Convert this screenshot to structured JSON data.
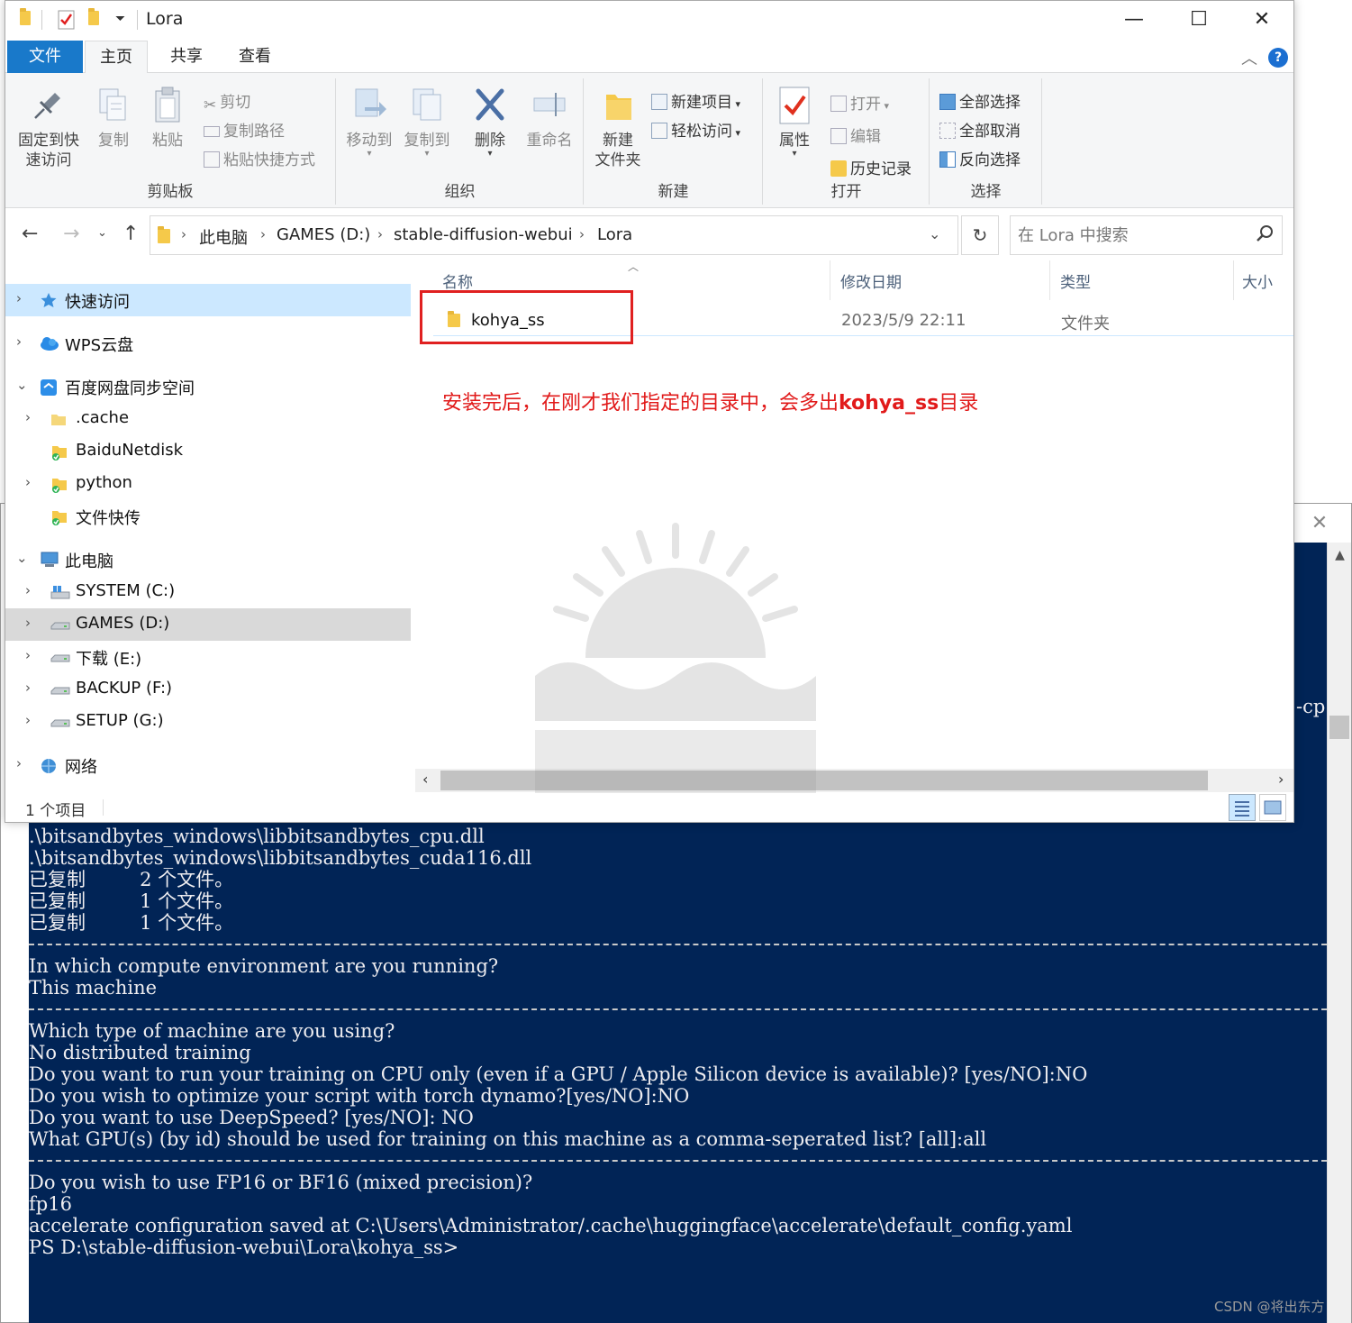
{
  "console": {
    "side_fragment": "-cp",
    "lines": [
      {
        "kind": "text",
        "text": ".\\bitsandbytes_windows\\libbitsandbytes_cpu.dll"
      },
      {
        "kind": "text",
        "text": ".\\bitsandbytes_windows\\libbitsandbytes_cuda116.dll"
      },
      {
        "kind": "text",
        "text": "已复制         2 个文件。"
      },
      {
        "kind": "text",
        "text": "已复制         1 个文件。"
      },
      {
        "kind": "text",
        "text": "已复制         1 个文件。"
      },
      {
        "kind": "sep",
        "text": ""
      },
      {
        "kind": "text",
        "text": "In which compute environment are you running?"
      },
      {
        "kind": "text",
        "text": "This machine"
      },
      {
        "kind": "sep",
        "text": ""
      },
      {
        "kind": "text",
        "text": "Which type of machine are you using?"
      },
      {
        "kind": "text",
        "text": "No distributed training"
      },
      {
        "kind": "text",
        "text": "Do you want to run your training on CPU only (even if a GPU / Apple Silicon device is available)? [yes/NO]:NO"
      },
      {
        "kind": "text",
        "text": "Do you wish to optimize your script with torch dynamo?[yes/NO]:NO"
      },
      {
        "kind": "text",
        "text": "Do you want to use DeepSpeed? [yes/NO]: NO"
      },
      {
        "kind": "text",
        "text": "What GPU(s) (by id) should be used for training on this machine as a comma-seperated list? [all]:all"
      },
      {
        "kind": "sep",
        "text": ""
      },
      {
        "kind": "text",
        "text": "Do you wish to use FP16 or BF16 (mixed precision)?"
      },
      {
        "kind": "text",
        "text": "fp16"
      },
      {
        "kind": "text",
        "text": "accelerate configuration saved at C:\\Users\\Administrator/.cache\\huggingface\\accelerate\\default_config.yaml"
      },
      {
        "kind": "text",
        "text": "PS D:\\stable-diffusion-webui\\Lora\\kohya_ss>"
      }
    ]
  },
  "explorer": {
    "title": "Lora",
    "tabs": {
      "file": "文件",
      "home": "主页",
      "share": "共享",
      "view": "查看"
    },
    "ribbon": {
      "clipboard": {
        "label": "剪贴板",
        "pin": "固定到快\n速访问",
        "copy": "复制",
        "paste": "粘贴",
        "cut": "剪切",
        "copy_path": "复制路径",
        "paste_shortcut": "粘贴快捷方式"
      },
      "organize": {
        "label": "组织",
        "move_to": "移动到",
        "copy_to": "复制到",
        "delete": "删除",
        "rename": "重命名"
      },
      "new": {
        "label": "新建",
        "new_folder": "新建\n文件夹",
        "new_item": "新建项目",
        "easy_access": "轻松访问"
      },
      "open": {
        "label": "打开",
        "properties": "属性",
        "open": "打开",
        "edit": "编辑",
        "history": "历史记录"
      },
      "select": {
        "label": "选择",
        "select_all": "全部选择",
        "select_none": "全部取消",
        "invert": "反向选择"
      }
    },
    "address": {
      "crumbs": [
        "此电脑",
        "GAMES (D:)",
        "stable-diffusion-webui",
        "Lora"
      ],
      "search_placeholder": "在 Lora 中搜索"
    },
    "nav": [
      {
        "label": "快速访问",
        "level": 0,
        "state": "sel",
        "chev": "›",
        "icon": "star-icon"
      },
      {
        "label": "WPS云盘",
        "level": 0,
        "state": "",
        "chev": "›",
        "icon": "cloud-icon"
      },
      {
        "label": "百度网盘同步空间",
        "level": 0,
        "state": "",
        "chev": "⌄",
        "icon": "baidu-icon"
      },
      {
        "label": ".cache",
        "level": 1,
        "state": "",
        "chev": "›",
        "icon": "folder-icon"
      },
      {
        "label": "BaiduNetdisk",
        "level": 1,
        "state": "",
        "chev": "",
        "icon": "folder-sync-icon"
      },
      {
        "label": "python",
        "level": 1,
        "state": "",
        "chev": "›",
        "icon": "folder-sync-icon"
      },
      {
        "label": "文件快传",
        "level": 1,
        "state": "",
        "chev": "",
        "icon": "folder-sync-icon"
      },
      {
        "label": "此电脑",
        "level": 0,
        "state": "",
        "chev": "⌄",
        "icon": "computer-icon"
      },
      {
        "label": "SYSTEM (C:)",
        "level": 1,
        "state": "",
        "chev": "›",
        "icon": "system-drive-icon"
      },
      {
        "label": "GAMES (D:)",
        "level": 1,
        "state": "hov",
        "chev": "›",
        "icon": "drive-icon"
      },
      {
        "label": "下载 (E:)",
        "level": 1,
        "state": "",
        "chev": "›",
        "icon": "drive-icon"
      },
      {
        "label": "BACKUP (F:)",
        "level": 1,
        "state": "",
        "chev": "›",
        "icon": "drive-icon"
      },
      {
        "label": "SETUP (G:)",
        "level": 1,
        "state": "",
        "chev": "›",
        "icon": "drive-icon"
      },
      {
        "label": "网络",
        "level": 0,
        "state": "",
        "chev": "›",
        "icon": "network-icon"
      }
    ],
    "columns": {
      "name": "名称",
      "date": "修改日期",
      "type": "类型",
      "size": "大小"
    },
    "files": [
      {
        "name": "kohya_ss",
        "date": "2023/5/9 22:11",
        "type": "文件夹"
      }
    ],
    "annotation_pre": "安装完后，在刚才我们指定的目录中，会多出",
    "annotation_bold": "kohya_ss",
    "annotation_post": "目录",
    "status": "1 个项目"
  },
  "footer": {
    "credit": "CSDN @将出东方"
  },
  "colors": {
    "accent": "#1979ca",
    "console_bg": "#012456",
    "annotation": "#e11a1a",
    "selection": "#cce8ff"
  }
}
